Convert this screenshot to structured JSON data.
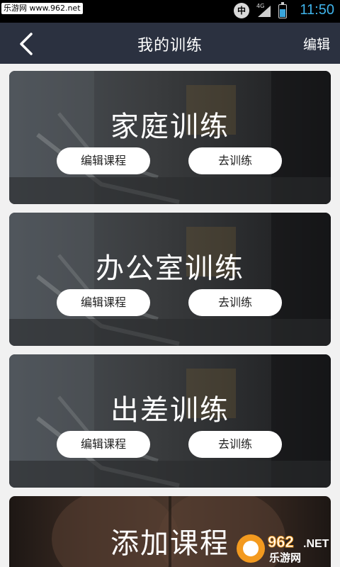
{
  "status_bar": {
    "watermark_left": "乐游网 www.962.net",
    "ime_label": "中",
    "network": "4G",
    "battery_level": 0.6,
    "time": "11:50"
  },
  "app_bar": {
    "title": "我的训练",
    "edit_label": "编辑"
  },
  "cards": [
    {
      "title": "家庭训练",
      "edit_course_label": "编辑课程",
      "go_train_label": "去训练"
    },
    {
      "title": "办公室训练",
      "edit_course_label": "编辑课程",
      "go_train_label": "去训练"
    },
    {
      "title": "出差训练",
      "edit_course_label": "编辑课程",
      "go_train_label": "去训练"
    }
  ],
  "add_card": {
    "title": "添加课程"
  },
  "watermark": {
    "brand": "962",
    "suffix": ".NET",
    "name": "乐游网"
  },
  "colors": {
    "app_bar": "#2b3140",
    "status_time": "#3fb3ea",
    "watermark_orange": "#f39a1f"
  }
}
